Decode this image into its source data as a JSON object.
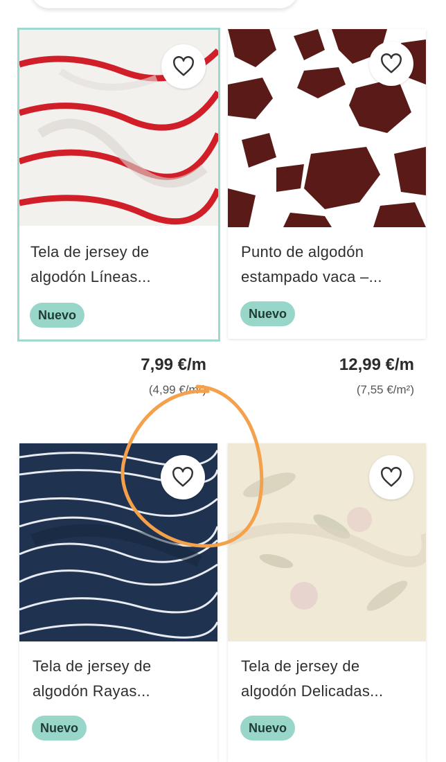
{
  "products": [
    {
      "name_line1": "Tela de jersey de",
      "name_line2": "algodón Líneas...",
      "badge": "Nuevo",
      "price": "7,99 €/m",
      "unit_price": "(4,99 €/m²)"
    },
    {
      "name_line1": "Punto de algodón",
      "name_line2": "estampado vaca –...",
      "badge": "Nuevo",
      "price": "12,99 €/m",
      "unit_price": "(7,55 €/m²)"
    },
    {
      "name_line1": "Tela de jersey de",
      "name_line2": "algodón Rayas...",
      "badge": "Nuevo"
    },
    {
      "name_line1": "Tela de jersey de",
      "name_line2": "algodón Delicadas...",
      "badge": "Nuevo"
    }
  ],
  "colors": {
    "badge": "#97d6c9",
    "selected_border": "#9ed8cf",
    "annotation": "#f5a04a"
  },
  "icons": {
    "favorite": "heart-outline-icon"
  }
}
